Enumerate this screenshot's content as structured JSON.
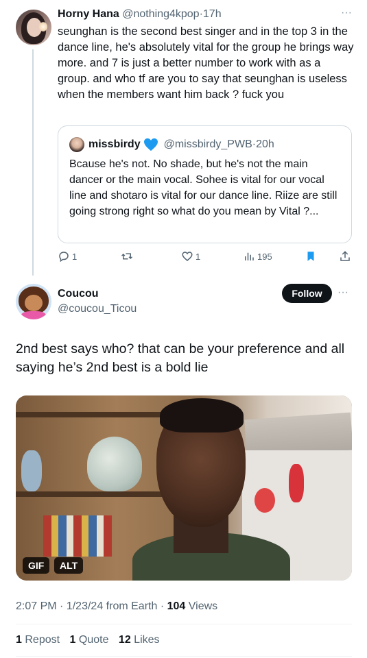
{
  "parent_tweet": {
    "display_name": "Horny Hana",
    "handle": "@nothing4kpop",
    "separator": "·",
    "time": "17h",
    "more_icon": "more-dots-icon",
    "text": "seunghan is the second best singer and in the top 3 in the dance line, he's absolutely vital for the group he brings way more. and 7 is just a better number to work with as a group. and who tf are you to say that seunghan is useless when the members want him back ? fuck you",
    "quote": {
      "display_name": "missbirdy",
      "verified_icon": "blue-heart-icon",
      "handle": "@missbirdy_PWB",
      "separator": "·",
      "time": "20h",
      "text": "Bcause he's not. No shade, but he's not the main dancer or the main vocal. Sohee is vital for our vocal line and shotaro is vital for our dance line. Riize are still going strong right so what do you mean by Vital ?..."
    },
    "actions": {
      "replies": "1",
      "retweets": "",
      "likes": "1",
      "views": "195"
    }
  },
  "reply_tweet": {
    "display_name": "Coucou",
    "handle": "@coucou_Ticou",
    "follow_label": "Follow",
    "text": "2nd best says who? that can be your preference and all saying he’s 2nd best is a bold lie",
    "media": {
      "gif_badge": "GIF",
      "alt_badge": "ALT"
    },
    "meta": {
      "time": "2:07 PM",
      "date": "1/23/24",
      "source": "from Earth",
      "separator": "·",
      "views_count": "104",
      "views_label": "Views"
    },
    "stats": {
      "reposts_count": "1",
      "reposts_label": "Repost",
      "quotes_count": "1",
      "quotes_label": "Quote",
      "likes_count": "12",
      "likes_label": "Likes"
    }
  },
  "colors": {
    "text": "#0f1419",
    "secondary": "#536471",
    "accent": "#1d9bf0",
    "border": "#cfd9de"
  }
}
